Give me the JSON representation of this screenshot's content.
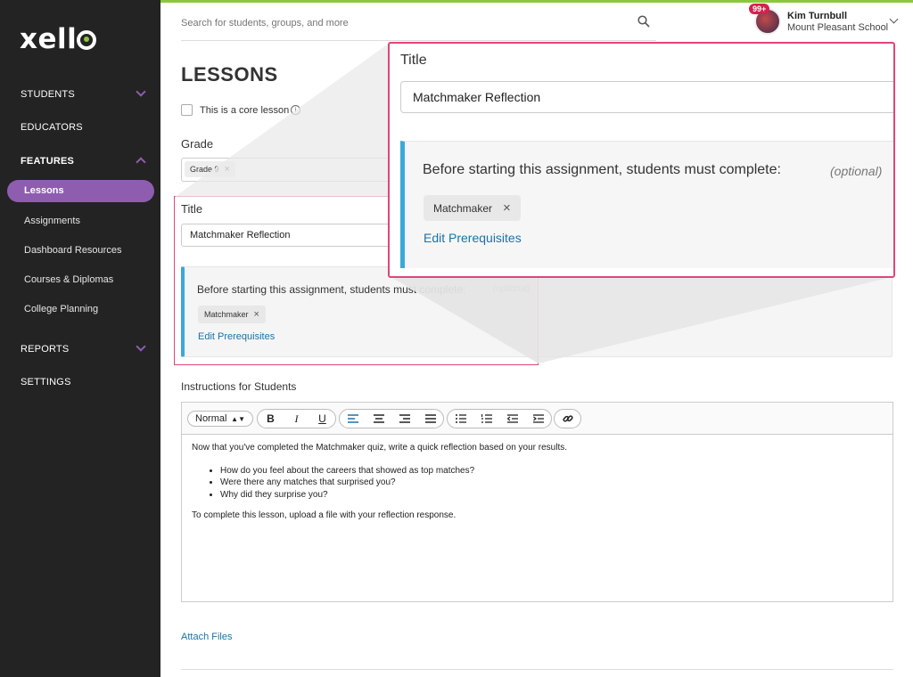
{
  "sidebar": {
    "logo": "xello",
    "students": "STUDENTS",
    "educators": "EDUCATORS",
    "features": "FEATURES",
    "lessons": "Lessons",
    "assignments": "Assignments",
    "dashboard_resources": "Dashboard Resources",
    "courses_diplomas": "Courses & Diplomas",
    "college_planning": "College Planning",
    "reports": "REPORTS",
    "settings": "SETTINGS"
  },
  "header": {
    "search_placeholder": "Search for students, groups, and more",
    "badge": "99+",
    "user_name": "Kim Turnbull",
    "user_school": "Mount Pleasant School"
  },
  "main": {
    "page_title": "LESSONS",
    "core_lesson_label": "This is a core lesson",
    "grade_label": "Grade",
    "grade_chip": "Grade 9",
    "title_label": "Title",
    "title_value": "Matchmaker Reflection",
    "prereq_text": "Before starting this assignment, students must complete:",
    "prereq_optional": "(optional)",
    "prereq_chip": "Matchmaker",
    "edit_prereq": "Edit Prerequisites",
    "instructions_label": "Instructions for Students",
    "editor": {
      "format_select": "Normal",
      "para1": "Now that you've completed the Matchmaker quiz, write a quick reflection based on your results.",
      "bullets": [
        "How do you feel about the careers that showed as top matches?",
        "Were there any matches that surprised you?",
        "Why did they surprise you?"
      ],
      "para2": "To complete this lesson, upload a file with your reflection response."
    },
    "attach_files": "Attach Files"
  },
  "colors": {
    "accent_purple": "#8e5db0",
    "highlight_pink": "#e0457b",
    "link_blue": "#1a73a8",
    "prereq_bar": "#3aa9d8",
    "brand_green": "#8cc63f"
  },
  "icons": {
    "chip_remove": "×",
    "search": "search-icon",
    "info": "info-icon"
  }
}
